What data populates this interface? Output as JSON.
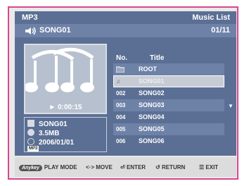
{
  "header": {
    "left": "MP3",
    "right": "Music List"
  },
  "song": {
    "title": "SONG01",
    "count": "01/11"
  },
  "player": {
    "time": "► 0:00:15"
  },
  "details": {
    "name": "SONG01",
    "size": "3.5MB",
    "date": "2006/01/01",
    "format": "MP3"
  },
  "columns": {
    "no": "No.",
    "title": "Title"
  },
  "tracks": [
    {
      "no": "",
      "title": "ROOT",
      "icon": "folder-icon"
    },
    {
      "no": "",
      "title": "SONG01",
      "icon": "note-icon"
    },
    {
      "no": "002",
      "title": "SONG02"
    },
    {
      "no": "003",
      "title": "SONG03"
    },
    {
      "no": "004",
      "title": "SONG04"
    },
    {
      "no": "005",
      "title": "SONG05"
    },
    {
      "no": "006",
      "title": "SONG06"
    }
  ],
  "footer": {
    "anykey": "Anykey",
    "play_mode": "PLAY MODE",
    "move": "MOVE",
    "enter": "ENTER",
    "return": "RETURN",
    "exit": "EXIT"
  },
  "colors": {
    "frame": "#d9468f",
    "panel": "#5b6f94",
    "panel_light": "#6e82a8",
    "selected": "#c6cbd4"
  }
}
